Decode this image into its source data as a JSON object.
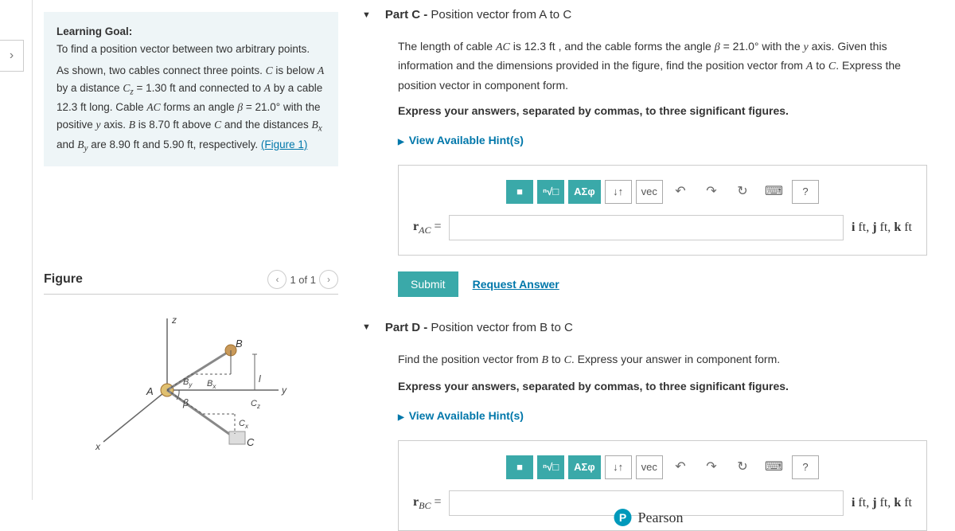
{
  "left_panel": {
    "goal_label": "Learning Goal:",
    "goal_text": "To find a position vector between two arbitrary points.",
    "description_html": "As shown, two cables connect three points. <span class='ital'>C</span> is below <span class='ital'>A</span> by a distance <span class='ital'>C<sub>z</sub></span> = 1.30 ft and connected to <span class='ital'>A</span> by a cable 12.3 ft long. Cable <span class='ital'>AC</span> forms an angle <span class='ital'>β</span> = 21.0° with the positive <span class='ital'>y</span> axis. <span class='ital'>B</span> is 8.70 ft above <span class='ital'>C</span> and the distances <span class='ital'>B<sub>x</sub></span> and <span class='ital'>B<sub>y</sub></span> are 8.90 ft and 5.90 ft, respectively. ",
    "figure_link": "(Figure 1)",
    "figure_title": "Figure",
    "figure_nav": "1 of 1"
  },
  "partC": {
    "part_label": "Part C - ",
    "part_title": "Position vector from A to C",
    "prompt_html": "The length of cable <span class='ital'>AC</span> is 12.3 ft , and the cable forms the angle <span class='ital'>β</span> = 21.0° with the <span class='ital'>y</span> axis. Given this information and the dimensions provided in the figure, find the position vector from <span class='ital'>A</span> to <span class='ital'>C</span>. Express the position vector in component form.",
    "instruction": "Express your answers, separated by commas, to three significant figures.",
    "hints": "View Available Hint(s)",
    "lhs_sub": "AC",
    "units": "i ft, j ft, k ft",
    "submit": "Submit",
    "request": "Request Answer"
  },
  "partD": {
    "part_label": "Part D - ",
    "part_title": "Position vector from B to C",
    "prompt_html": "Find the position vector from <span class='ital'>B</span> to <span class='ital'>C</span>. Express your answer in component form.",
    "instruction": "Express your answers, separated by commas, to three significant figures.",
    "hints": "View Available Hint(s)",
    "lhs_sub": "BC",
    "units": "i ft, j ft, k ft"
  },
  "toolbar": {
    "template": "■",
    "root": "ⁿ√□",
    "greek": "ΑΣφ",
    "arrows": "↓↑",
    "vec": "vec",
    "undo": "↶",
    "redo": "↷",
    "reset": "↻",
    "keyboard": "⌨",
    "help": "?"
  },
  "footer": "Pearson"
}
